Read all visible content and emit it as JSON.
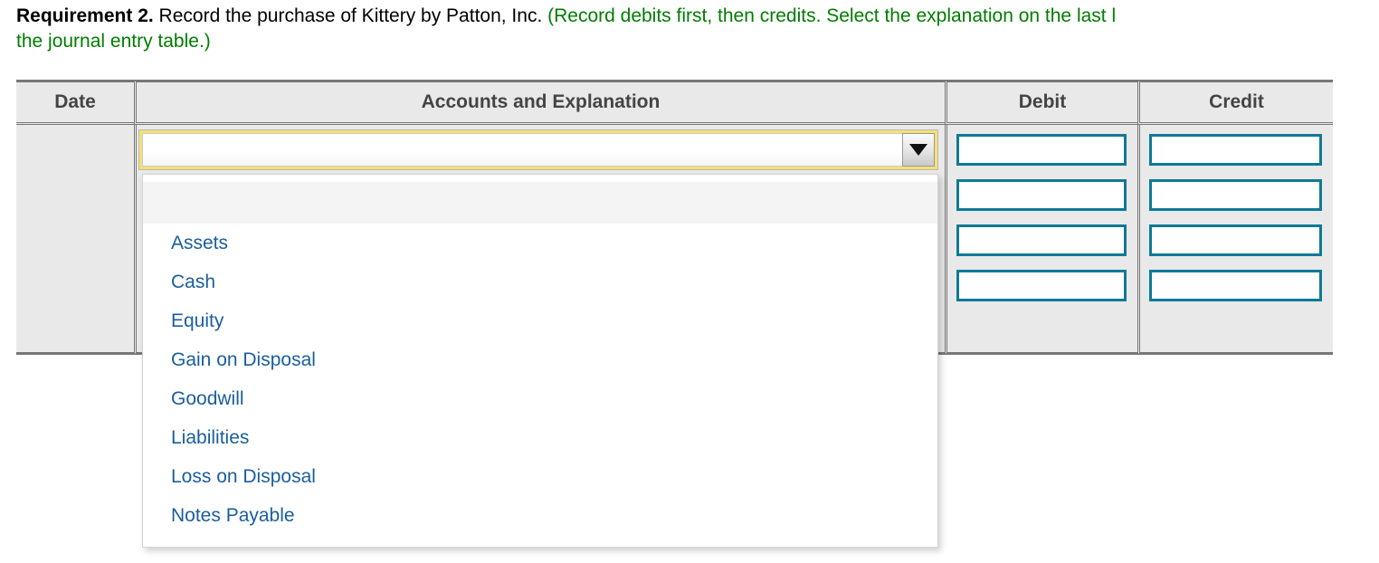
{
  "prompt": {
    "label": "Requirement 2.",
    "task": " Record the purchase of Kittery by Patton, Inc. ",
    "instruction_line1": "(Record debits first, then credits. Select the explanation on the last l",
    "instruction_line2": "the journal entry table.)"
  },
  "table": {
    "headers": {
      "date": "Date",
      "accounts": "Accounts and Explanation",
      "debit": "Debit",
      "credit": "Credit"
    },
    "date_cell_value": "",
    "debit_rows": [
      "",
      "",
      "",
      ""
    ],
    "credit_rows": [
      "",
      "",
      "",
      ""
    ]
  },
  "account_select": {
    "value": "",
    "placeholder": "",
    "arrow_icon": "chevron-down-icon",
    "expanded": true,
    "options": [
      "",
      "Assets",
      "Cash",
      "Equity",
      "Gain on Disposal",
      "Goodwill",
      "Liabilities",
      "Loss on Disposal",
      "Notes Payable"
    ]
  },
  "colors": {
    "instruction_green": "#007d00",
    "option_blue": "#1a5e9e",
    "input_border_teal": "#0f7996",
    "focus_yellow": "#f6e073",
    "header_gray": "#e9e9e9",
    "border_gray": "#777777"
  }
}
